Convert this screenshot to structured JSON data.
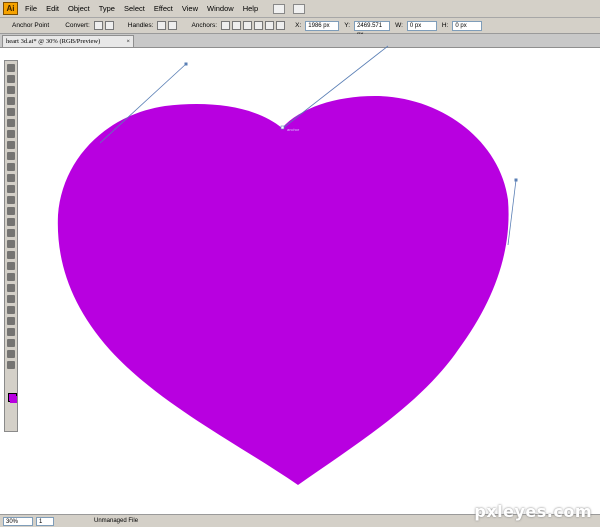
{
  "app": {
    "logo_text": "Ai"
  },
  "menu": {
    "items": [
      "File",
      "Edit",
      "Object",
      "Type",
      "Select",
      "Effect",
      "View",
      "Window",
      "Help"
    ]
  },
  "control_bar": {
    "anchor_point_label": "Anchor Point",
    "convert_label": "Convert:",
    "handles_label": "Handles:",
    "anchors_label": "Anchors:",
    "x_label": "X:",
    "x_value": "1986 px",
    "y_label": "Y:",
    "y_value": "2469.571 px",
    "w_label": "W:",
    "w_value": "0 px",
    "h_label": "H:",
    "h_value": "0 px"
  },
  "document": {
    "tab_title": "heart 3d.ai* @ 30% (RGB/Preview)",
    "close_glyph": "×",
    "anchor_hint": "anchor"
  },
  "status": {
    "zoom": "30%",
    "artboard": "1",
    "file_status": "Unmanaged File"
  },
  "watermark": "pxleyes.com",
  "colors": {
    "heart_fill": "#b800e0",
    "ui_gray": "#d4d0c8",
    "path_handle": "#5a7fb5"
  }
}
